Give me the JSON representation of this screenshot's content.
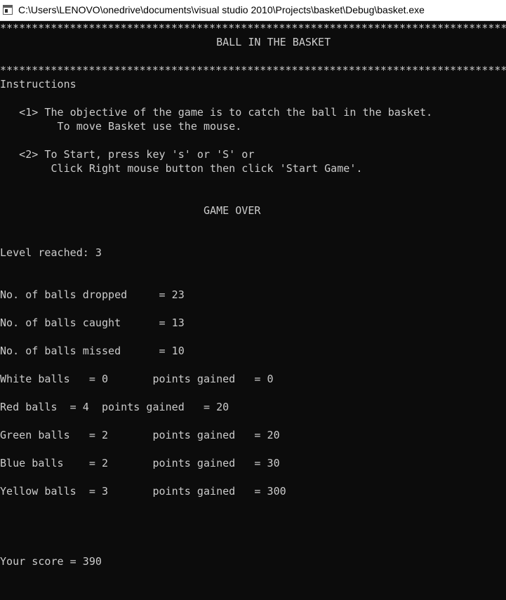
{
  "window": {
    "title": "C:\\Users\\LENOVO\\onedrive\\documents\\visual studio 2010\\Projects\\basket\\Debug\\basket.exe",
    "icon": "console-app-icon"
  },
  "console": {
    "lines": [
      "****************************************************************************************************",
      "                                  BALL IN THE BASKET",
      "",
      "****************************************************************************************************",
      "Instructions",
      "",
      "   <1> The objective of the game is to catch the ball in the basket.",
      "         To move Basket use the mouse.",
      "",
      "   <2> To Start, press key 's' or 'S' or",
      "        Click Right mouse button then click 'Start Game'.",
      "",
      "",
      "                                GAME OVER",
      "",
      "",
      "Level reached: 3",
      "",
      "",
      "No. of balls dropped     = 23",
      "",
      "No. of balls caught      = 13",
      "",
      "No. of balls missed      = 10",
      "",
      "White balls   = 0       points gained   = 0",
      "",
      "Red balls  = 4  points gained   = 20",
      "",
      "Green balls   = 2       points gained   = 20",
      "",
      "Blue balls    = 2       points gained   = 30",
      "",
      "Yellow balls  = 3       points gained   = 300",
      "",
      "",
      "",
      "",
      "Your score = 390"
    ]
  }
}
